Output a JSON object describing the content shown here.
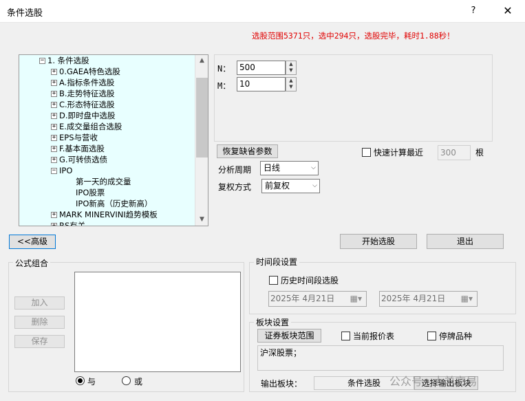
{
  "window": {
    "title": "条件选股",
    "help": "?",
    "close": "✕"
  },
  "status_text": "选股范围5371只，选中294只，选股完毕，耗时1.88秒！",
  "tree": {
    "items": [
      {
        "expander": "⊟",
        "label": "1. 条件选股"
      },
      {
        "expander": "⊞",
        "label": "0.GAEA特色选股"
      },
      {
        "expander": "⊞",
        "label": "A.指标条件选股"
      },
      {
        "expander": "⊞",
        "label": "B.走势特征选股"
      },
      {
        "expander": "⊞",
        "label": "C.形态特征选股"
      },
      {
        "expander": "⊞",
        "label": "D.即时盘中选股"
      },
      {
        "expander": "⊞",
        "label": "E.成交量组合选股"
      },
      {
        "expander": "⊞",
        "label": "EPS与营收"
      },
      {
        "expander": "⊞",
        "label": "F.基本面选股"
      },
      {
        "expander": "⊞",
        "label": "G.可转债选债"
      },
      {
        "expander": "⊟",
        "label": "IPO"
      },
      {
        "expander": "",
        "label": "第一天的成交量"
      },
      {
        "expander": "",
        "label": "IPO股票"
      },
      {
        "expander": "",
        "label": "IPO新高（历史新高）"
      },
      {
        "expander": "⊞",
        "label": "MARK MINERVINI趋势模板"
      },
      {
        "expander": "⊞",
        "label": "RS有关"
      }
    ],
    "scroll_up": "▲",
    "scroll_down": "▼"
  },
  "params": {
    "n_label": "N：",
    "n_value": "500",
    "m_label": "M：",
    "m_value": "10",
    "spin_up": "▲",
    "spin_down": "▼"
  },
  "restore_defaults": "恢复缺省参数",
  "fast_calc": {
    "label": "快速计算最近",
    "value": "300",
    "unit": "根"
  },
  "period": {
    "label": "分析周期",
    "value": "日线"
  },
  "adjust": {
    "label": "复权方式",
    "value": "前复权"
  },
  "combo_arrow": "⌵",
  "advanced_button": "<<高级",
  "start_button": "开始选股",
  "exit_button": "退出",
  "formula_group": {
    "title": "公式组合",
    "add": "加入",
    "delete": "删除",
    "save": "保存",
    "radio_and": "与",
    "radio_or": "或"
  },
  "time_group": {
    "title": "时间段设置",
    "history_label": "历史时间段选股",
    "start_date": "2025年  4月21日",
    "end_date": "2025年  4月21日",
    "date_icon": "▦▾"
  },
  "block_group": {
    "title": "板块设置",
    "range_button": "证券板块范围",
    "current_quote": "当前报价表",
    "suspended": "停牌品种",
    "range_text": "沪深股票；",
    "output_label": "输出板块：",
    "output_value": "条件选股",
    "output_button": "选择输出板块"
  },
  "watermark": "公众号 · 大羊交易"
}
